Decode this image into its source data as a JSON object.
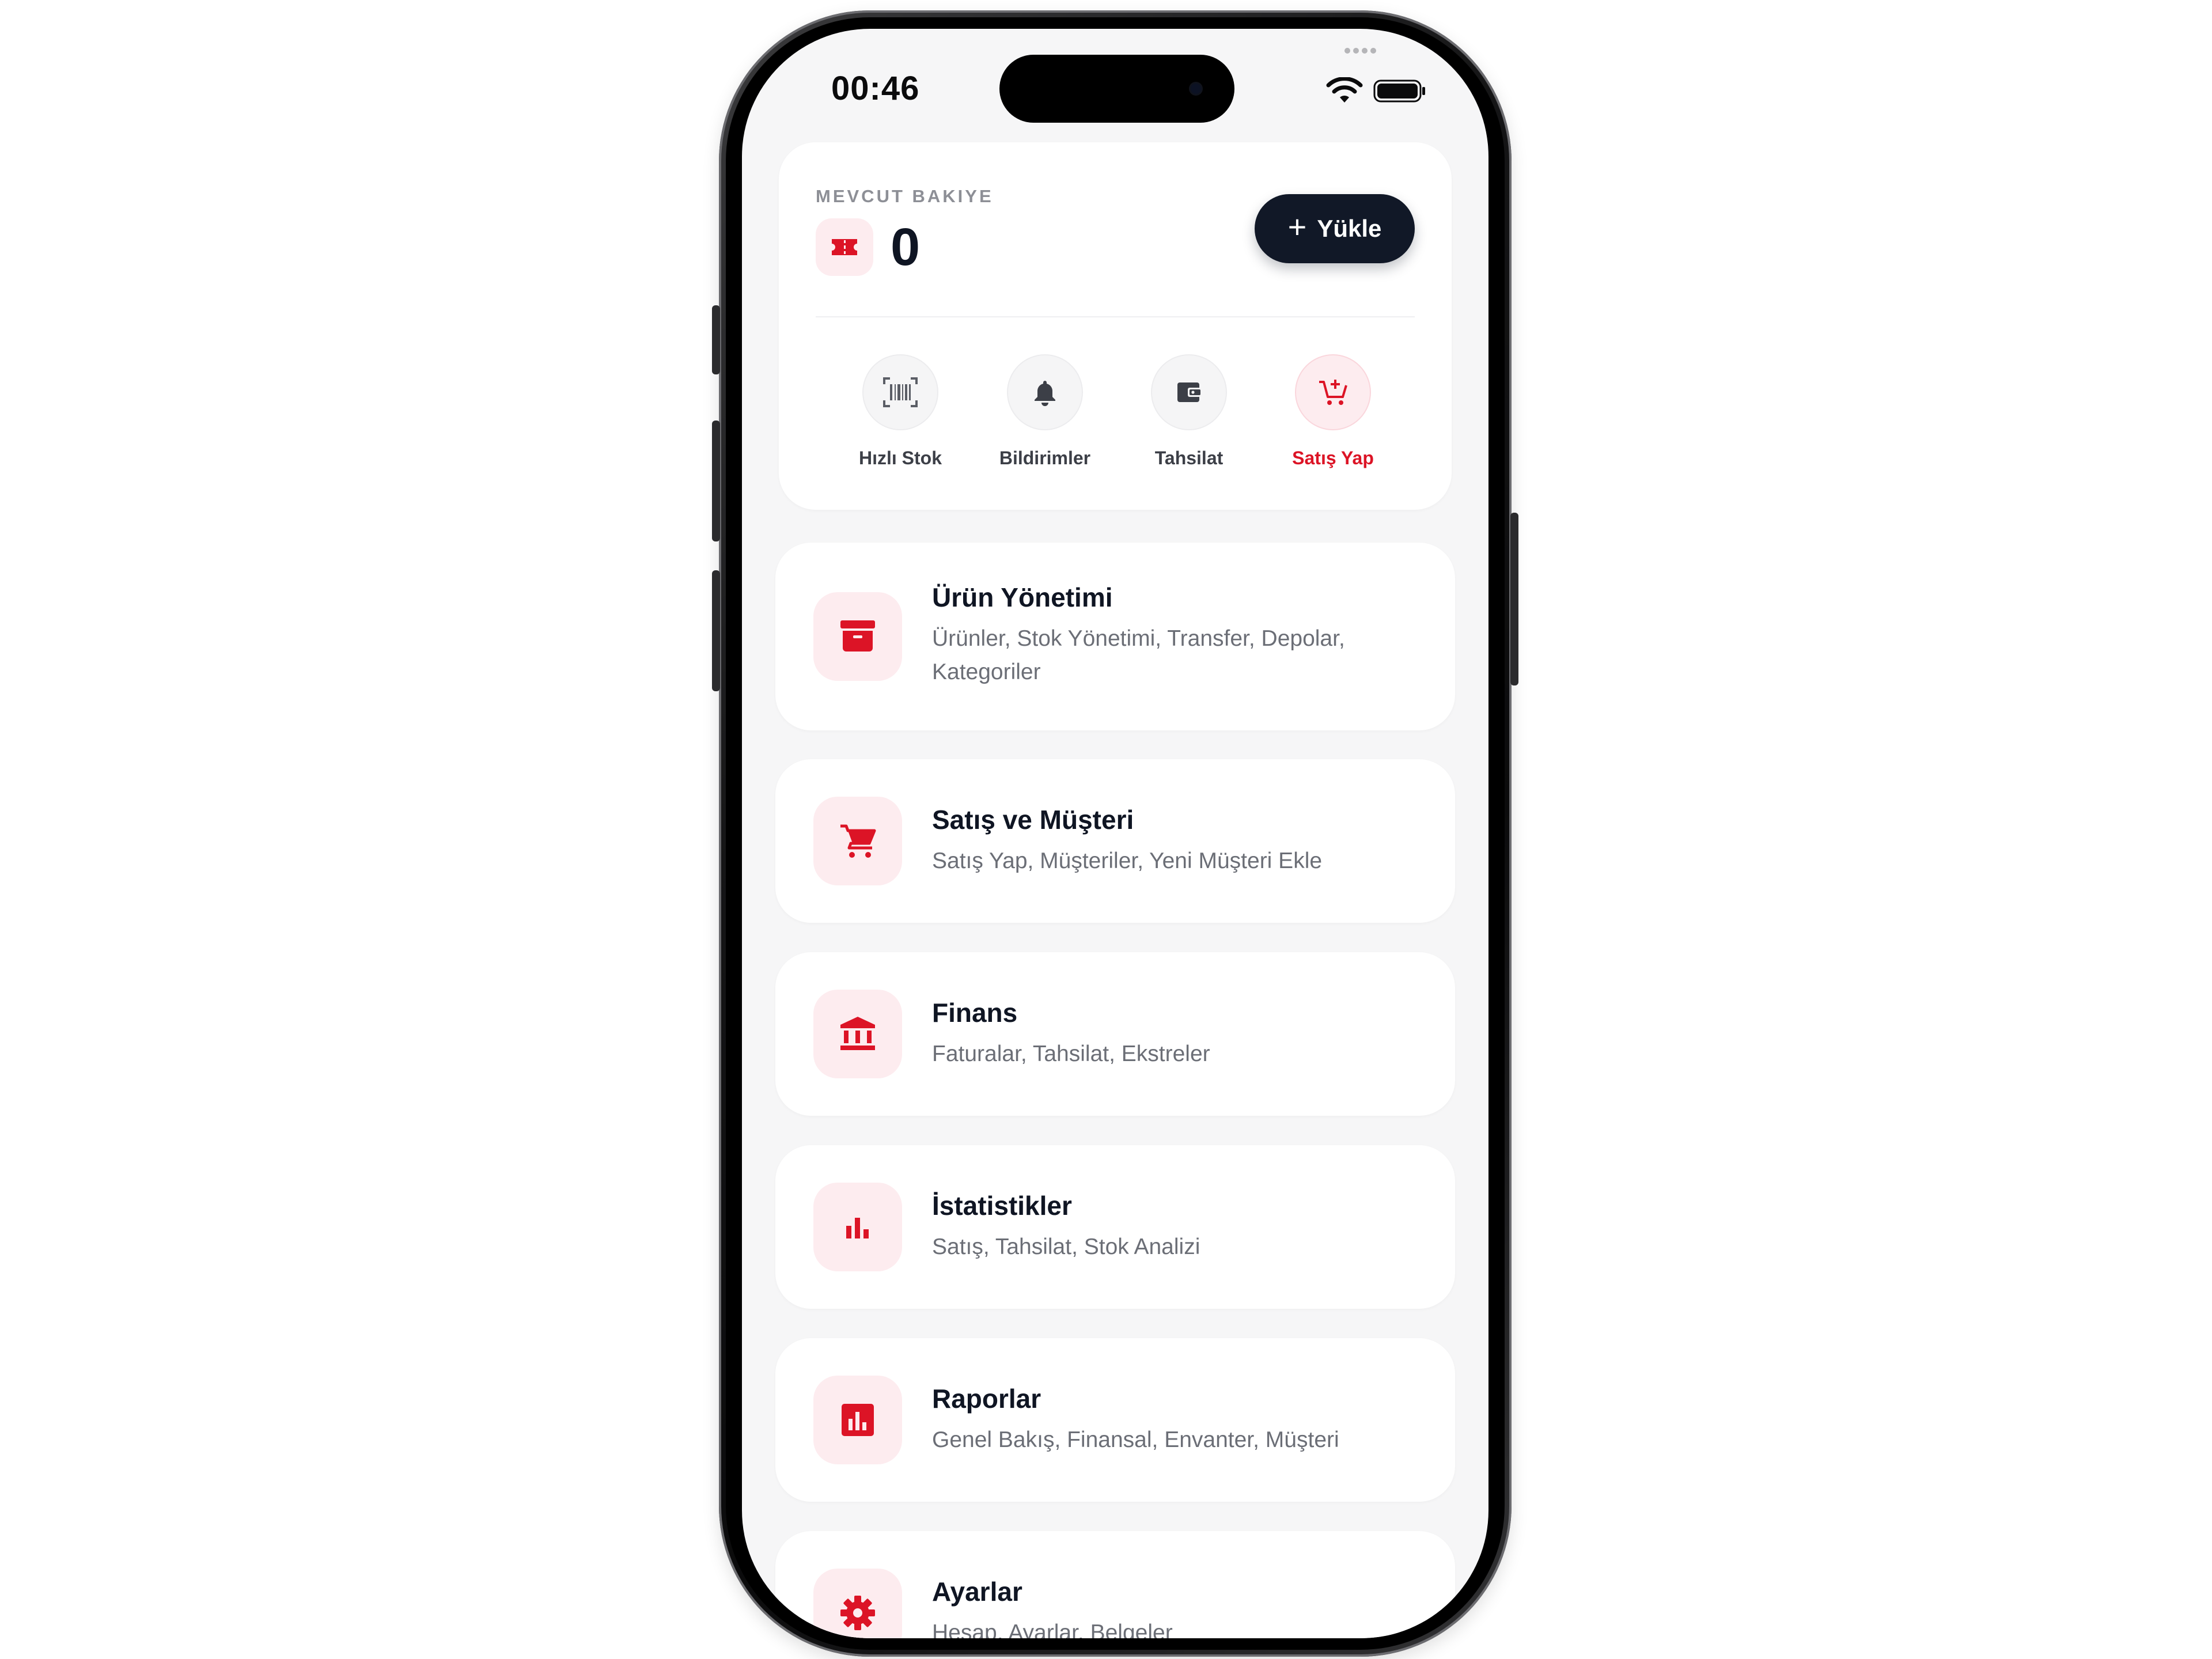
{
  "status_bar": {
    "time": "00:46"
  },
  "balance": {
    "label": "MEVCUT BAKIYE",
    "amount": "0",
    "load_button": "Yükle"
  },
  "quick_actions": [
    {
      "label": "Hızlı Stok",
      "icon": "barcode-scan-icon",
      "active": false
    },
    {
      "label": "Bildirimler",
      "icon": "bell-icon",
      "active": false
    },
    {
      "label": "Tahsilat",
      "icon": "wallet-icon",
      "active": false
    },
    {
      "label": "Satış Yap",
      "icon": "cart-add-icon",
      "active": true
    }
  ],
  "menu": [
    {
      "title": "Ürün Yönetimi",
      "subtitle": "Ürünler, Stok Yönetimi, Transfer, Depolar, Kategoriler",
      "icon": "archive-box-icon"
    },
    {
      "title": "Satış ve Müşteri",
      "subtitle": "Satış Yap, Müşteriler, Yeni Müşteri Ekle",
      "icon": "cart-icon"
    },
    {
      "title": "Finans",
      "subtitle": "Faturalar, Tahsilat, Ekstreler",
      "icon": "bank-icon"
    },
    {
      "title": "İstatistikler",
      "subtitle": "Satış, Tahsilat, Stok Analizi",
      "icon": "bar-chart-icon"
    },
    {
      "title": "Raporlar",
      "subtitle": "Genel Bakış, Finansal, Envanter, Müşteri",
      "icon": "report-icon"
    },
    {
      "title": "Ayarlar",
      "subtitle": "Hesap, Ayarlar, Belgeler",
      "icon": "gear-icon"
    }
  ],
  "colors": {
    "accent": "#dc1426",
    "accent_soft": "#fdecef",
    "dark_button": "#111827"
  }
}
